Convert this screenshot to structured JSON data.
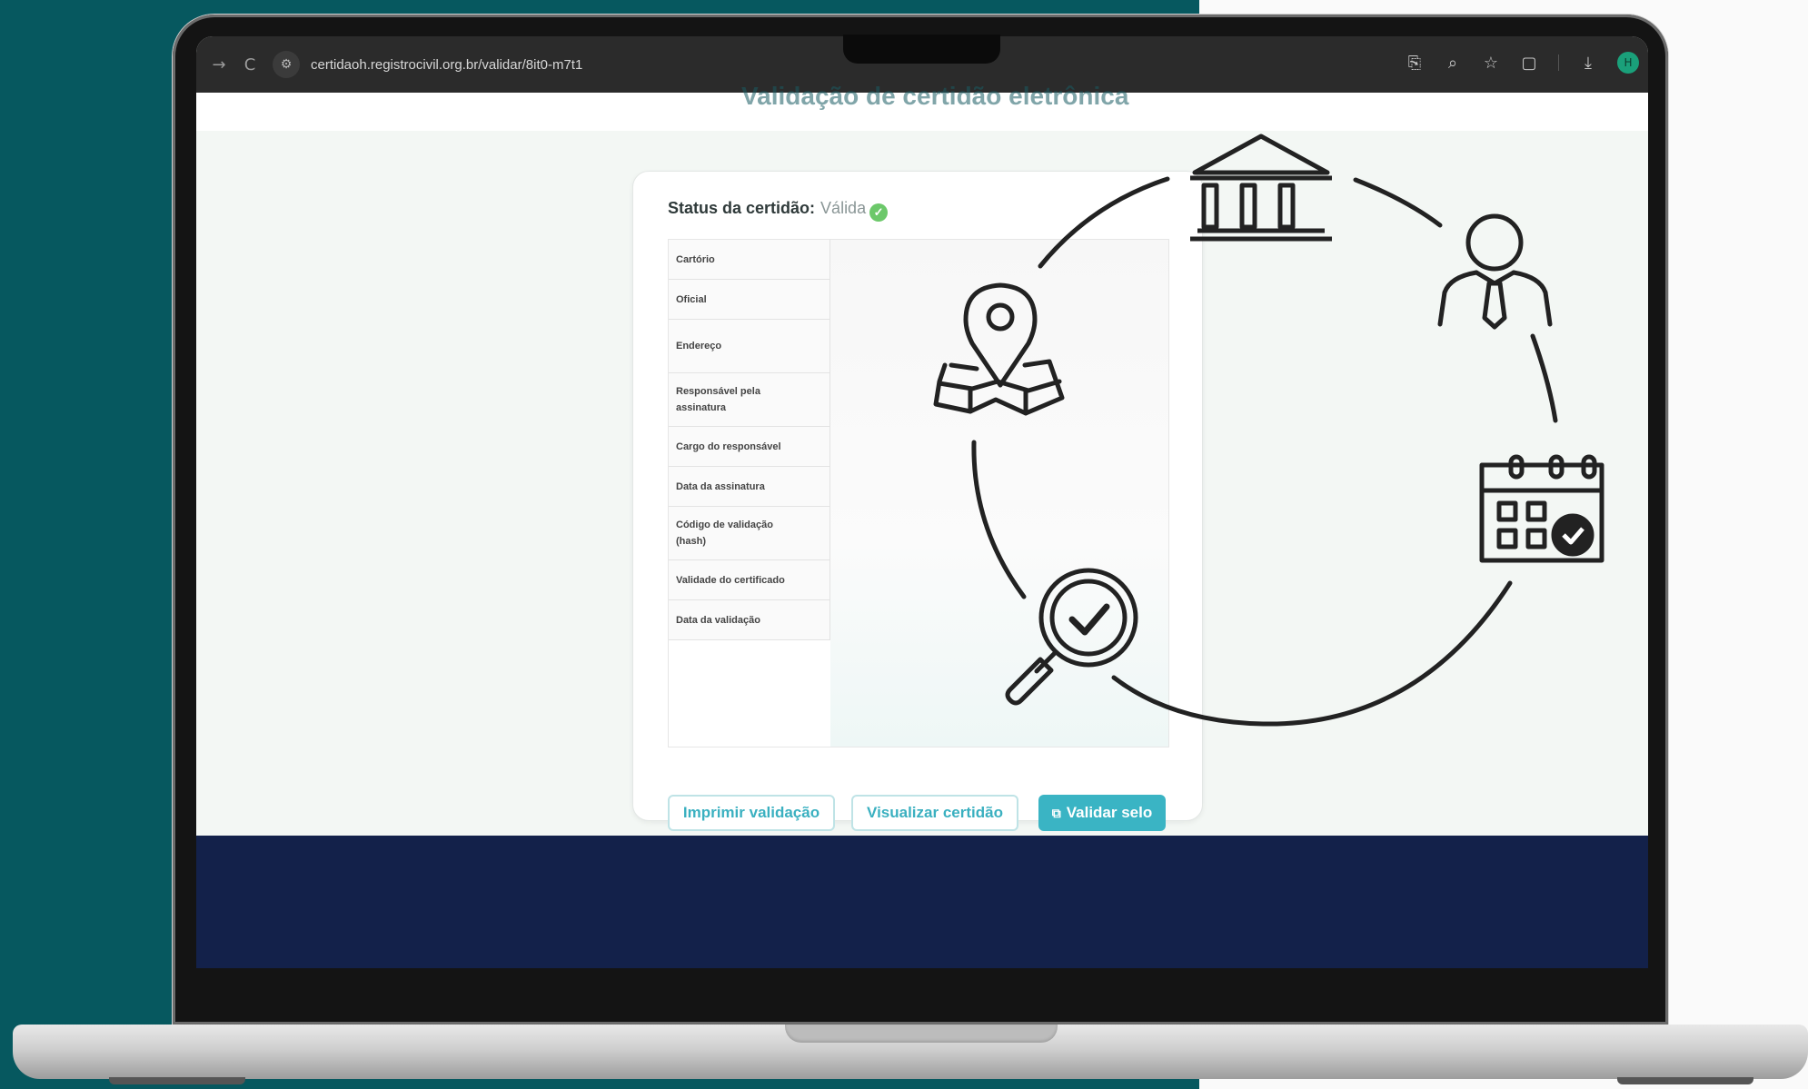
{
  "browser": {
    "back": "→",
    "reload": "C",
    "url": "certidaoh.registrocivil.org.br/validar/8it0-m7t1",
    "profile_initial": "H"
  },
  "page": {
    "heading": "Validação de certidão eletrônica",
    "status_label": "Status da certidão:",
    "status_value": "Válida"
  },
  "table": {
    "rows": [
      "Cartório",
      "Oficial",
      "Endereço",
      "Responsável pela assinatura",
      "Cargo do responsável",
      "Data da assinatura",
      "Código de validação (hash)",
      "Validade do certificado",
      "Data da validação"
    ]
  },
  "buttons": {
    "print": "Imprimir validação",
    "view": "Visualizar certidão",
    "seal": "Validar selo"
  },
  "colors": {
    "accent": "#3ab4c4",
    "background_left": "#06585f",
    "footer": "#13214a",
    "status_ok": "#6cc86a"
  },
  "overlay_icons": [
    "bank-icon",
    "person-icon",
    "calendar-check-icon",
    "magnifier-check-icon",
    "map-pin-icon"
  ]
}
